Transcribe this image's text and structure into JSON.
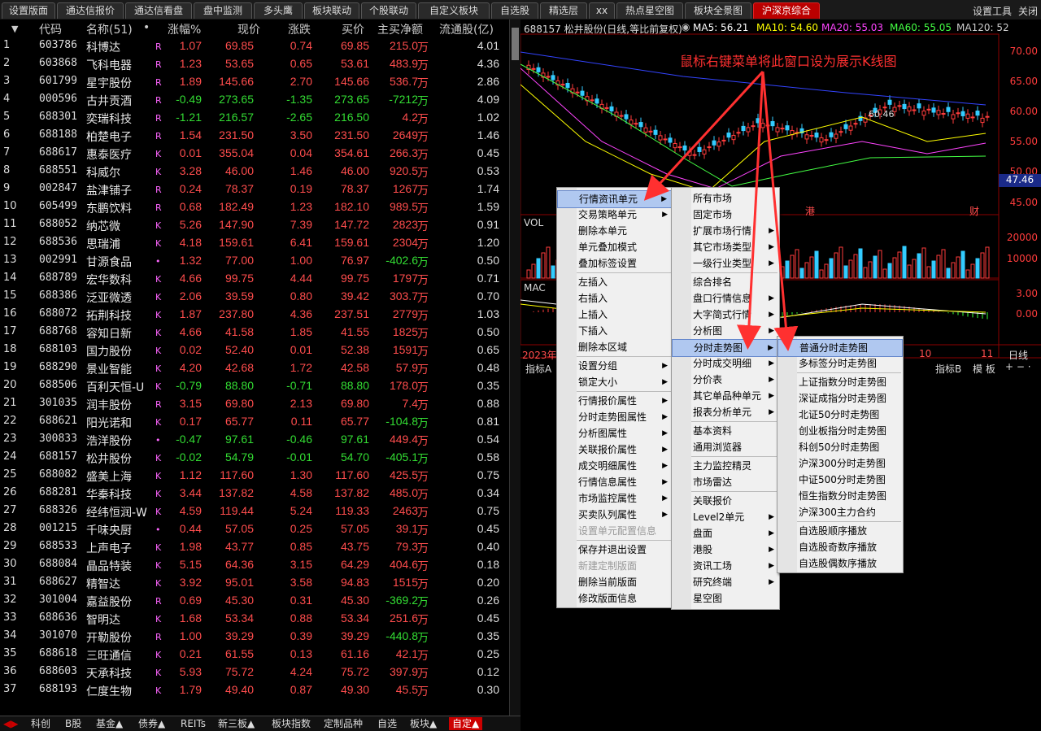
{
  "topbar": {
    "tabs": [
      "设置版面",
      "通达信报价",
      "通达信看盘",
      "盘中监测",
      "多头鹰",
      "板块联动",
      "个股联动",
      "自定义板块",
      "自选股",
      "精选层",
      "xx",
      "热点星空图",
      "板块全景图",
      "沪深京综合"
    ],
    "active": "沪深京综合",
    "settings_tool": "设置工具",
    "close": "关闭"
  },
  "table": {
    "headers": {
      "sort": "▼",
      "code": "代码",
      "name": "名称(51)",
      "dot": "•",
      "pct": "涨幅%",
      "price": "现价",
      "chg": "涨跌",
      "buy": "买价",
      "net": "主买净额",
      "float": "流通股(亿)"
    },
    "unit": "万",
    "rows": [
      {
        "idx": "1",
        "code": "603786",
        "name": "科博达",
        "flag": "R",
        "pct": "1.07",
        "price": "69.85",
        "chg": "0.74",
        "buy": "69.85",
        "net": "215.0",
        "float": "4.01"
      },
      {
        "idx": "2",
        "code": "603868",
        "name": "飞科电器",
        "flag": "R",
        "pct": "1.23",
        "price": "53.65",
        "chg": "0.65",
        "buy": "53.61",
        "net": "483.9",
        "float": "4.36"
      },
      {
        "idx": "3",
        "code": "601799",
        "name": "星宇股份",
        "flag": "R",
        "pct": "1.89",
        "price": "145.66",
        "chg": "2.70",
        "buy": "145.66",
        "net": "536.7",
        "float": "2.86"
      },
      {
        "idx": "4",
        "code": "000596",
        "name": "古井贡酒",
        "flag": "R",
        "pct": "-0.49",
        "price": "273.65",
        "chg": "-1.35",
        "buy": "273.65",
        "net": "-7212",
        "float": "4.09"
      },
      {
        "idx": "5",
        "code": "688301",
        "name": "奕瑞科技",
        "flag": "R",
        "pct": "-1.21",
        "price": "216.57",
        "chg": "-2.65",
        "buy": "216.50",
        "net": "4.2",
        "float": "1.02"
      },
      {
        "idx": "6",
        "code": "688188",
        "name": "柏楚电子",
        "flag": "R",
        "pct": "1.54",
        "price": "231.50",
        "chg": "3.50",
        "buy": "231.50",
        "net": "2649",
        "float": "1.46"
      },
      {
        "idx": "7",
        "code": "688617",
        "name": "惠泰医疗",
        "flag": "K",
        "pct": "0.01",
        "price": "355.04",
        "chg": "0.04",
        "buy": "354.61",
        "net": "266.3",
        "float": "0.45"
      },
      {
        "idx": "8",
        "code": "688551",
        "name": "科威尔",
        "flag": "K",
        "pct": "3.28",
        "price": "46.00",
        "chg": "1.46",
        "buy": "46.00",
        "net": "920.5",
        "float": "0.53"
      },
      {
        "idx": "9",
        "code": "002847",
        "name": "盐津铺子",
        "flag": "R",
        "pct": "0.24",
        "price": "78.37",
        "chg": "0.19",
        "buy": "78.37",
        "net": "1267",
        "float": "1.74"
      },
      {
        "idx": "10",
        "code": "605499",
        "name": "东鹏饮料",
        "flag": "R",
        "pct": "0.68",
        "price": "182.49",
        "chg": "1.23",
        "buy": "182.10",
        "net": "989.5",
        "float": "1.59"
      },
      {
        "idx": "11",
        "code": "688052",
        "name": "纳芯微",
        "flag": "K",
        "pct": "5.26",
        "price": "147.90",
        "chg": "7.39",
        "buy": "147.72",
        "net": "2823",
        "float": "0.91"
      },
      {
        "idx": "12",
        "code": "688536",
        "name": "思瑞浦",
        "flag": "K",
        "pct": "4.18",
        "price": "159.61",
        "chg": "6.41",
        "buy": "159.61",
        "net": "2304",
        "float": "1.20"
      },
      {
        "idx": "13",
        "code": "002991",
        "name": "甘源食品",
        "flag": "•",
        "pct": "1.32",
        "price": "77.00",
        "chg": "1.00",
        "buy": "76.97",
        "net": "-402.6",
        "float": "0.50"
      },
      {
        "idx": "14",
        "code": "688789",
        "name": "宏华数科",
        "flag": "K",
        "pct": "4.66",
        "price": "99.75",
        "chg": "4.44",
        "buy": "99.75",
        "net": "1797",
        "float": "0.71"
      },
      {
        "idx": "15",
        "code": "688386",
        "name": "泛亚微透",
        "flag": "K",
        "pct": "2.06",
        "price": "39.59",
        "chg": "0.80",
        "buy": "39.42",
        "net": "303.7",
        "float": "0.70"
      },
      {
        "idx": "16",
        "code": "688072",
        "name": "拓荆科技",
        "flag": "K",
        "pct": "1.87",
        "price": "237.80",
        "chg": "4.36",
        "buy": "237.51",
        "net": "2779",
        "float": "1.03"
      },
      {
        "idx": "17",
        "code": "688768",
        "name": "容知日新",
        "flag": "K",
        "pct": "4.66",
        "price": "41.58",
        "chg": "1.85",
        "buy": "41.55",
        "net": "1825",
        "float": "0.50"
      },
      {
        "idx": "18",
        "code": "688103",
        "name": "国力股份",
        "flag": "K",
        "pct": "0.02",
        "price": "52.40",
        "chg": "0.01",
        "buy": "52.38",
        "net": "1591",
        "float": "0.65"
      },
      {
        "idx": "19",
        "code": "688290",
        "name": "景业智能",
        "flag": "K",
        "pct": "4.20",
        "price": "42.68",
        "chg": "1.72",
        "buy": "42.58",
        "net": "57.9",
        "float": "0.48"
      },
      {
        "idx": "20",
        "code": "688506",
        "name": "百利天恒-U",
        "flag": "K",
        "pct": "-0.79",
        "price": "88.80",
        "chg": "-0.71",
        "buy": "88.80",
        "net": "178.0",
        "float": "0.35"
      },
      {
        "idx": "21",
        "code": "301035",
        "name": "润丰股份",
        "flag": "R",
        "pct": "3.15",
        "price": "69.80",
        "chg": "2.13",
        "buy": "69.80",
        "net": "7.4",
        "float": "0.88"
      },
      {
        "idx": "22",
        "code": "688621",
        "name": "阳光诺和",
        "flag": "K",
        "pct": "0.17",
        "price": "65.77",
        "chg": "0.11",
        "buy": "65.77",
        "net": "-104.8",
        "float": "0.81"
      },
      {
        "idx": "23",
        "code": "300833",
        "name": "浩洋股份",
        "flag": "•",
        "pct": "-0.47",
        "price": "97.61",
        "chg": "-0.46",
        "buy": "97.61",
        "net": "449.4",
        "float": "0.54"
      },
      {
        "idx": "24",
        "code": "688157",
        "name": "松井股份",
        "flag": "K",
        "pct": "-0.02",
        "price": "54.79",
        "chg": "-0.01",
        "buy": "54.70",
        "net": "-405.1",
        "float": "0.58"
      },
      {
        "idx": "25",
        "code": "688082",
        "name": "盛美上海",
        "flag": "K",
        "pct": "1.12",
        "price": "117.60",
        "chg": "1.30",
        "buy": "117.60",
        "net": "425.5",
        "float": "0.75"
      },
      {
        "idx": "26",
        "code": "688281",
        "name": "华秦科技",
        "flag": "K",
        "pct": "3.44",
        "price": "137.82",
        "chg": "4.58",
        "buy": "137.82",
        "net": "485.0",
        "float": "0.34"
      },
      {
        "idx": "27",
        "code": "688326",
        "name": "经纬恒润-W",
        "flag": "K",
        "pct": "4.59",
        "price": "119.44",
        "chg": "5.24",
        "buy": "119.33",
        "net": "2463",
        "float": "0.75"
      },
      {
        "idx": "28",
        "code": "001215",
        "name": "千味央厨",
        "flag": "•",
        "pct": "0.44",
        "price": "57.05",
        "chg": "0.25",
        "buy": "57.05",
        "net": "39.1",
        "float": "0.45"
      },
      {
        "idx": "29",
        "code": "688533",
        "name": "上声电子",
        "flag": "K",
        "pct": "1.98",
        "price": "43.77",
        "chg": "0.85",
        "buy": "43.75",
        "net": "79.3",
        "float": "0.40"
      },
      {
        "idx": "30",
        "code": "688084",
        "name": "晶品特装",
        "flag": "K",
        "pct": "5.15",
        "price": "64.36",
        "chg": "3.15",
        "buy": "64.29",
        "net": "404.6",
        "float": "0.18"
      },
      {
        "idx": "31",
        "code": "688627",
        "name": "精智达",
        "flag": "K",
        "pct": "3.92",
        "price": "95.01",
        "chg": "3.58",
        "buy": "94.83",
        "net": "1515",
        "float": "0.20"
      },
      {
        "idx": "32",
        "code": "301004",
        "name": "嘉益股份",
        "flag": "R",
        "pct": "0.69",
        "price": "45.30",
        "chg": "0.31",
        "buy": "45.30",
        "net": "-369.2",
        "float": "0.26"
      },
      {
        "idx": "33",
        "code": "688636",
        "name": "智明达",
        "flag": "K",
        "pct": "1.68",
        "price": "53.34",
        "chg": "0.88",
        "buy": "53.34",
        "net": "251.6",
        "float": "0.45"
      },
      {
        "idx": "34",
        "code": "301070",
        "name": "开勒股份",
        "flag": "R",
        "pct": "1.00",
        "price": "39.29",
        "chg": "0.39",
        "buy": "39.29",
        "net": "-440.8",
        "float": "0.35"
      },
      {
        "idx": "35",
        "code": "688618",
        "name": "三旺通信",
        "flag": "K",
        "pct": "0.21",
        "price": "61.55",
        "chg": "0.13",
        "buy": "61.16",
        "net": "42.1",
        "float": "0.25"
      },
      {
        "idx": "36",
        "code": "688603",
        "name": "天承科技",
        "flag": "K",
        "pct": "5.93",
        "price": "75.72",
        "chg": "4.24",
        "buy": "75.72",
        "net": "397.9",
        "float": "0.12"
      },
      {
        "idx": "37",
        "code": "688193",
        "name": "仁度生物",
        "flag": "K",
        "pct": "1.79",
        "price": "49.40",
        "chg": "0.87",
        "buy": "49.30",
        "net": "45.5",
        "float": "0.30"
      }
    ]
  },
  "bottom_tabs": [
    "科创",
    "B股",
    "基金▲",
    "债券▲",
    "REITs",
    "新三板▲",
    "板块指数",
    "定制品种",
    "自选",
    "板块▲",
    "自定▲"
  ],
  "bottom_active": "自定▲",
  "chart": {
    "title": "688157 松井股份(日线,等比前复权)",
    "ma": [
      {
        "label": "MA5: 56.21",
        "color": "#ffffff"
      },
      {
        "label": "MA10: 54.60",
        "color": "#ffff00"
      },
      {
        "label": "MA20: 55.03",
        "color": "#ff44ff"
      },
      {
        "label": "MA60: 55.05",
        "color": "#44ff44"
      },
      {
        "label": "MA120: 52",
        "color": "#cccccc"
      }
    ],
    "y_ticks": [
      "70.00",
      "65.00",
      "60.00",
      "55.00",
      "50.00",
      "45.00"
    ],
    "high_label": "60.46",
    "price_tag": "47.46",
    "marker_port": "港",
    "marker_fin": "财",
    "vol_label": "VOL",
    "vol_ticks": [
      "20000",
      "10000"
    ],
    "macd_label": "MAC",
    "macd_ticks": [
      "3.00",
      "0.00"
    ],
    "date_left": "2023年",
    "date_mid": "10",
    "date_right": "11",
    "period": "日线",
    "bottom_left": "指标A",
    "bottom_right": "指标B",
    "templ": "模 板",
    "annotation": "鼠标右键菜单将此窗口设为展示K线图"
  },
  "menu1": {
    "items": [
      "行情资讯单元",
      "交易策略单元",
      "删除本单元",
      "单元叠加模式",
      "叠加标签设置",
      "左插入",
      "右插入",
      "上插入",
      "下插入",
      "删除本区域",
      "设置分组",
      "锁定大小",
      "行情报价属性",
      "分时走势图属性",
      "分析图属性",
      "关联报价属性",
      "成交明细属性",
      "行情信息属性",
      "市场监控属性",
      "买卖队列属性",
      "设置单元配置信息",
      "保存并退出设置",
      "新建定制版面",
      "删除当前版面",
      "修改版面信息"
    ]
  },
  "menu2": {
    "items": [
      "所有市场",
      "固定市场",
      "扩展市场行情",
      "其它市场类型",
      "一级行业类型",
      "综合排名",
      "盘口行情信息",
      "大字简式行情",
      "分析图",
      "分时走势图",
      "分时成交明细",
      "分价表",
      "其它单品种单元",
      "报表分析单元",
      "基本资料",
      "通用浏览器",
      "主力监控精灵",
      "市场雷达",
      "关联报价",
      "Level2单元",
      "盘面",
      "港股",
      "资讯工场",
      "研究终端",
      "星空图"
    ]
  },
  "menu3": {
    "items": [
      "普通分时走势图",
      "多标签分时走势图",
      "上证指数分时走势图",
      "深证成指分时走势图",
      "北证50分时走势图",
      "创业板指分时走势图",
      "科创50分时走势图",
      "沪深300分时走势图",
      "中证500分时走势图",
      "恒生指数分时走势图",
      "沪深300主力合约",
      "自选股顺序播放",
      "自选股奇数序播放",
      "自选股偶数序播放"
    ]
  }
}
